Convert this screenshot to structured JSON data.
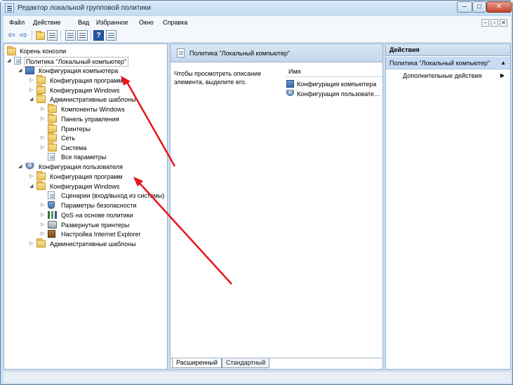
{
  "window": {
    "title": "Редактор локальной групповой политики"
  },
  "menubar": {
    "items": [
      "Файл",
      "Действие",
      "Вид",
      "Избранное",
      "Окно",
      "Справка"
    ]
  },
  "tree": {
    "root": "Корень консоли",
    "policy": "Политика \"Локальный компьютер\"",
    "computer_config": "Конфигурация компьютера",
    "cc_programs": "Конфигурация программ",
    "cc_windows": "Конфигурация Windows",
    "cc_admin": "Административные шаблоны",
    "cc_admin_children": [
      "Компоненты Windows",
      "Панель управления",
      "Принтеры",
      "Сеть",
      "Система",
      "Все параметры"
    ],
    "user_config": "Конфигурация пользователя",
    "uc_programs": "Конфигурация программ",
    "uc_windows": "Конфигурация Windows",
    "uc_windows_children": [
      "Сценарии (вход/выход из системы)",
      "Параметры безопасности",
      "QoS на основе политики",
      "Развернутые принтеры",
      "Настройка Internet Explorer"
    ],
    "uc_admin": "Административные шаблоны"
  },
  "middle": {
    "header": "Политика \"Локальный компьютер\"",
    "description": "Чтобы просмотреть описание элемента, выделите его.",
    "column_name": "Имя",
    "items": [
      "Конфигурация компьютера",
      "Конфигурация пользовате..."
    ],
    "tabs": [
      "Расширенный",
      "Стандартный"
    ]
  },
  "actions": {
    "header": "Действия",
    "subheader": "Политика \"Локальный компьютер\"",
    "more": "Дополнительные действия"
  },
  "icons": {
    "back": "back-arrow-icon",
    "forward": "forward-arrow-icon",
    "help": "?"
  }
}
